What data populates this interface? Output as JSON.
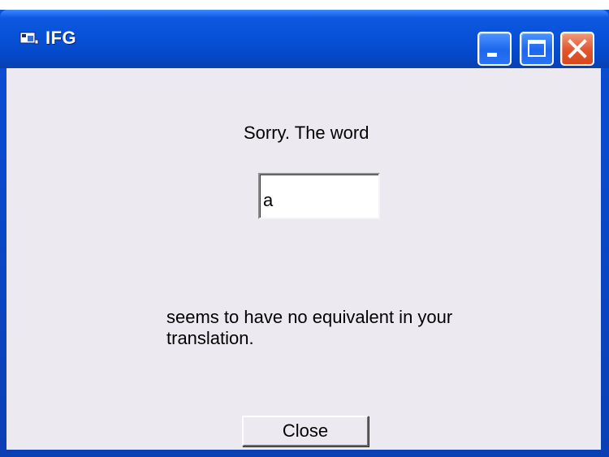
{
  "window": {
    "title": "IFG",
    "app_icon": "ifg-app-icon",
    "controls": {
      "minimize_icon": "minimize-icon",
      "maximize_icon": "maximize-icon",
      "close_icon": "close-icon"
    },
    "colors": {
      "titlebar": "#0852d8",
      "client_background": "#ece9f0",
      "close_button": "#e0562e"
    }
  },
  "dialog": {
    "message_top": "Sorry. The word",
    "word_value": "a",
    "message_bottom": "seems to have no equivalent in your translation.",
    "close_label": "Close"
  }
}
